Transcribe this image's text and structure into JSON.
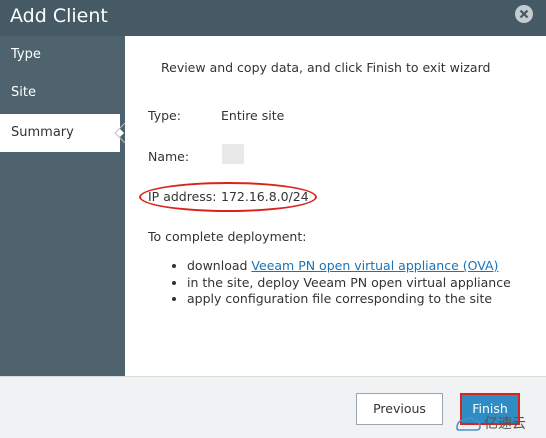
{
  "window": {
    "title": "Add Client"
  },
  "sidebar": {
    "items": [
      {
        "label": "Type"
      },
      {
        "label": "Site"
      },
      {
        "label": "Summary"
      }
    ]
  },
  "summary": {
    "heading": "Review and copy data, and click Finish to exit wizard",
    "type_label": "Type:",
    "type_value": "Entire site",
    "name_label": "Name:",
    "ip_label": "IP address:",
    "ip_value": "172.16.8.0/24",
    "deploy_title": "To complete deployment:",
    "steps": [
      {
        "prefix": "download ",
        "link": "Veeam PN open virtual appliance (OVA)"
      },
      {
        "text": "in the site, deploy Veeam PN open virtual appliance"
      },
      {
        "text": "apply configuration file corresponding to the site"
      }
    ]
  },
  "footer": {
    "previous_label": "Previous",
    "finish_label": "Finish"
  },
  "watermark": {
    "text": "亿速云"
  },
  "colors": {
    "titlebar": "#455a64",
    "sidebar": "#4e636d",
    "accent": "#2f8cc4",
    "annotation": "#d9241c",
    "link": "#1a73b8"
  }
}
